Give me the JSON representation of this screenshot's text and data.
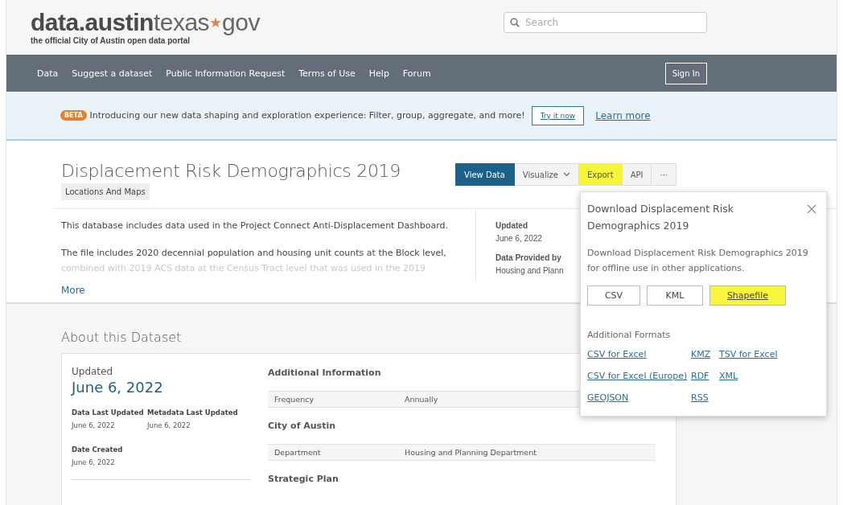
{
  "header": {
    "logo": {
      "bold": "data.austin",
      "light": "texas",
      "suffix": "gov",
      "tagline": "the official City of Austin open data portal"
    },
    "search": {
      "placeholder": "Search"
    }
  },
  "nav": {
    "items": [
      "Data",
      "Suggest a dataset",
      "Public Information Request",
      "Terms of Use",
      "Help",
      "Forum"
    ],
    "sign_in": "Sign In"
  },
  "banner": {
    "badge": "BETA",
    "text": "Introducing our new data shaping and exploration experience: Filter, group, aggregate, and more!",
    "try_button": "Try it now",
    "learn_link": "Learn more"
  },
  "dataset": {
    "title": "Displacement Risk Demographics 2019",
    "category": "Locations And Maps",
    "actions": [
      {
        "label": "View Data",
        "kind": "primary",
        "highlighted": false
      },
      {
        "label": "Visualize",
        "kind": "dropdown",
        "highlighted": false
      },
      {
        "label": "Export",
        "kind": "plain",
        "highlighted": true
      },
      {
        "label": "API",
        "kind": "plain",
        "highlighted": false
      },
      {
        "label": "···",
        "kind": "plain",
        "highlighted": false
      }
    ],
    "description": [
      "This database includes data used in the Project Connect Anti-Displacement Dashboard.",
      "The file includes 2020 decennial population and housing unit counts at the Block level,",
      "combined with 2019 ACS data at the Census Tract level that was used in the 2019"
    ],
    "more_link": "More",
    "meta": [
      {
        "label": "Updated",
        "value": "June 6, 2022"
      },
      {
        "label": "Data Provided by",
        "value": "Housing and Plann"
      }
    ]
  },
  "about": {
    "heading": "About this Dataset",
    "updated_label": "Updated",
    "updated_value": "June 6, 2022",
    "dates": [
      {
        "label": "Data Last Updated",
        "value": "June 6, 2022"
      },
      {
        "label": "Metadata Last Updated",
        "value": "June 6, 2022"
      },
      {
        "label": "Date Created",
        "value": "June 6, 2022"
      }
    ],
    "sections": [
      {
        "title": "Additional Information",
        "rows": [
          {
            "key": "Frequency",
            "value": "Annually"
          }
        ]
      },
      {
        "title": "City of Austin",
        "rows": [
          {
            "key": "Department",
            "value": "Housing and Planning Department"
          }
        ]
      },
      {
        "title": "Strategic Plan"
      }
    ]
  },
  "export_popover": {
    "title": "Download Displacement Risk Demographics 2019",
    "description": "Download Displacement Risk Demographics 2019 for offline use in other applications.",
    "formats": [
      {
        "label": "CSV",
        "highlighted": false
      },
      {
        "label": "KML",
        "highlighted": false
      },
      {
        "label": "Shapefile",
        "highlighted": true
      }
    ],
    "additional_heading": "Additional Formats",
    "additional_columns": [
      [
        "CSV for Excel",
        "CSV for Excel (Europe)",
        "GEOJSON"
      ],
      [
        "KMZ",
        "RDF",
        "RSS"
      ],
      [
        "TSV for Excel",
        "XML"
      ]
    ]
  }
}
